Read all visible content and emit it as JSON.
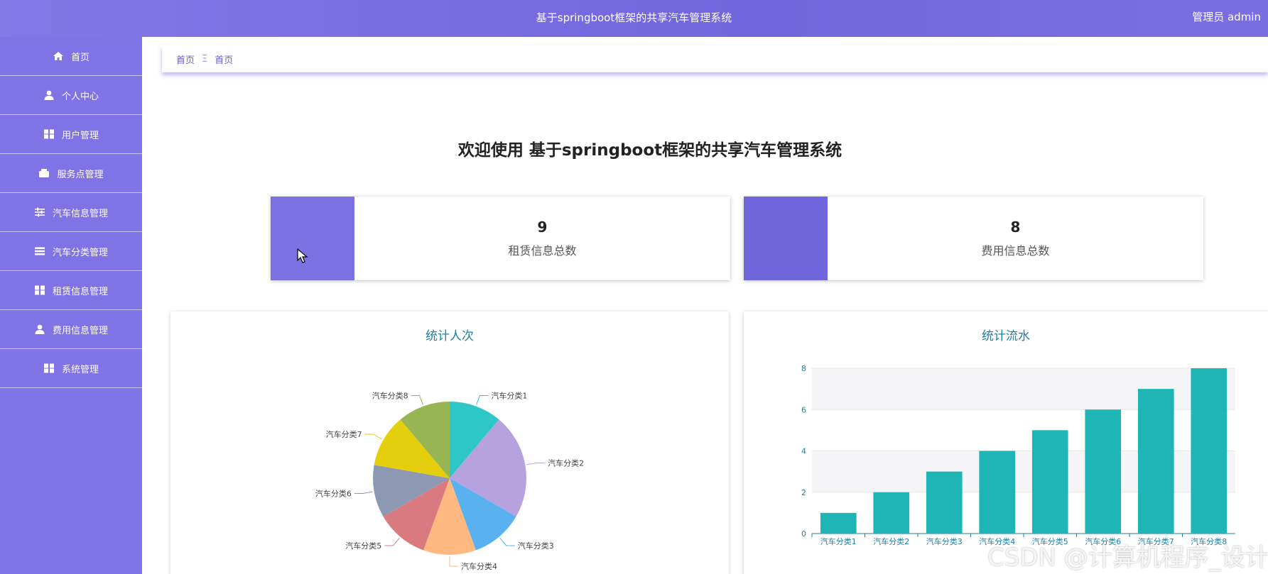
{
  "header": {
    "title": "基于springboot框架的共享汽车管理系统",
    "user": "管理员 admin"
  },
  "sidebar": {
    "items": [
      {
        "label": "首页",
        "icon": "home-icon"
      },
      {
        "label": "个人中心",
        "icon": "user-icon"
      },
      {
        "label": "用户管理",
        "icon": "grid-icon"
      },
      {
        "label": "服务点管理",
        "icon": "wallet-icon"
      },
      {
        "label": "汽车信息管理",
        "icon": "sliders-icon"
      },
      {
        "label": "汽车分类管理",
        "icon": "list-icon"
      },
      {
        "label": "租赁信息管理",
        "icon": "grid-icon"
      },
      {
        "label": "费用信息管理",
        "icon": "user-icon"
      },
      {
        "label": "系统管理",
        "icon": "grid-icon"
      }
    ]
  },
  "breadcrumb": {
    "root": "首页",
    "separator": "Ξ",
    "current": "首页"
  },
  "welcome": "欢迎使用 基于springboot框架的共享汽车管理系统",
  "cards": [
    {
      "value": "9",
      "label": "租赁信息总数",
      "color": "#7b71e3"
    },
    {
      "value": "8",
      "label": "费用信息总数",
      "color": "#6f66dc"
    }
  ],
  "charts": {
    "pie_title": "统计人次",
    "bar_title": "统计流水"
  },
  "chart_data": [
    {
      "type": "pie",
      "title": "统计人次",
      "categories": [
        "汽车分类1",
        "汽车分类2",
        "汽车分类3",
        "汽车分类4",
        "汽车分类5",
        "汽车分类6",
        "汽车分类7",
        "汽车分类8"
      ],
      "values": [
        1,
        2,
        1,
        1,
        1,
        1,
        1,
        1
      ],
      "labels_visible": [
        "汽车分类1",
        "汽车分类2",
        "汽车分类3",
        "汽车分类5",
        "汽车分类6",
        "汽车分类7",
        "汽车分类8"
      ],
      "colors": [
        "#2ec7c9",
        "#b6a2de",
        "#5ab1ef",
        "#ffb980",
        "#d87a80",
        "#8d98b3",
        "#e5cf0d",
        "#97b552"
      ]
    },
    {
      "type": "bar",
      "title": "统计流水",
      "categories": [
        "汽车分类1",
        "汽车分类2",
        "汽车分类3",
        "汽车分类4",
        "汽车分类5",
        "汽车分类6",
        "汽车分类7",
        "汽车分类8"
      ],
      "values": [
        1,
        2,
        3,
        4,
        5,
        6,
        7,
        8
      ],
      "ylim": [
        0,
        8
      ],
      "yticks": [
        "0",
        "2",
        "4",
        "6",
        "8"
      ],
      "color": "#1fb5b5"
    }
  ],
  "watermark": "CSDN @计算机程序_设计"
}
